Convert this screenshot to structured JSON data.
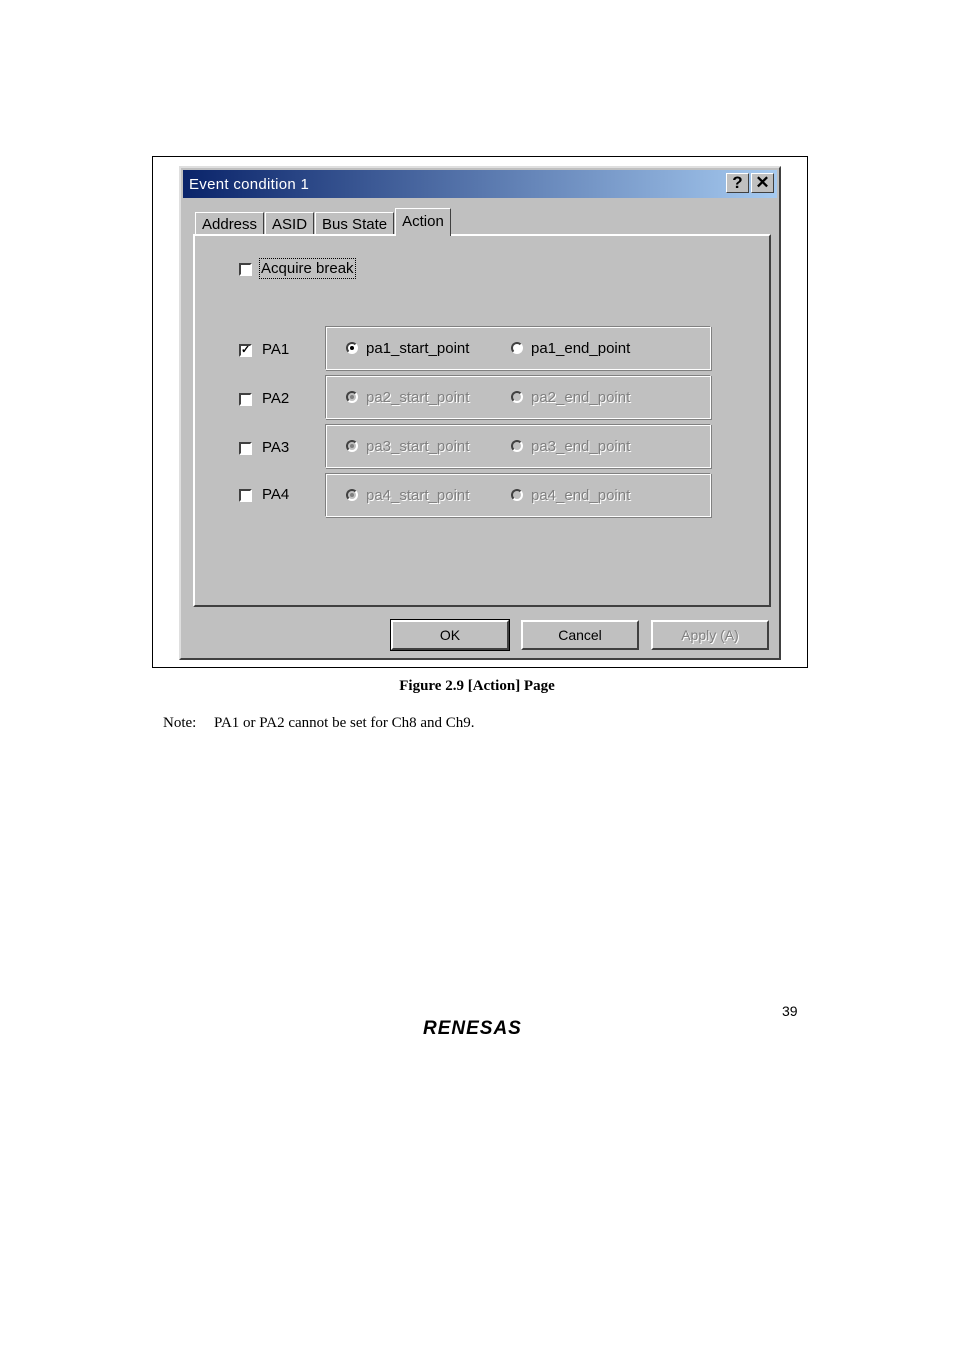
{
  "dialog": {
    "title": "Event condition 1",
    "help_icon": "?",
    "close_icon": "✕",
    "tabs": [
      {
        "label": "Address",
        "active": false
      },
      {
        "label": "ASID",
        "active": false
      },
      {
        "label": "Bus State",
        "active": false
      },
      {
        "label": "Action",
        "active": true
      }
    ],
    "acquire_break": {
      "label": "Acquire break",
      "checked": false
    },
    "pa_rows": [
      {
        "label": "PA1",
        "checked": true,
        "enabled": true,
        "start_label": "pa1_start_point",
        "end_label": "pa1_end_point",
        "selected": "start"
      },
      {
        "label": "PA2",
        "checked": false,
        "enabled": false,
        "start_label": "pa2_start_point",
        "end_label": "pa2_end_point",
        "selected": "start"
      },
      {
        "label": "PA3",
        "checked": false,
        "enabled": false,
        "start_label": "pa3_start_point",
        "end_label": "pa3_end_point",
        "selected": "start"
      },
      {
        "label": "PA4",
        "checked": false,
        "enabled": false,
        "start_label": "pa4_start_point",
        "end_label": "pa4_end_point",
        "selected": "start"
      }
    ],
    "buttons": {
      "ok": "OK",
      "cancel": "Cancel",
      "apply": "Apply (A)"
    }
  },
  "caption": "Figure 2.9   [Action] Page",
  "note": {
    "label": "Note:",
    "text": "PA1 or PA2 cannot be set for Ch8 and Ch9."
  },
  "page_number": "39",
  "logo": "RENESAS"
}
